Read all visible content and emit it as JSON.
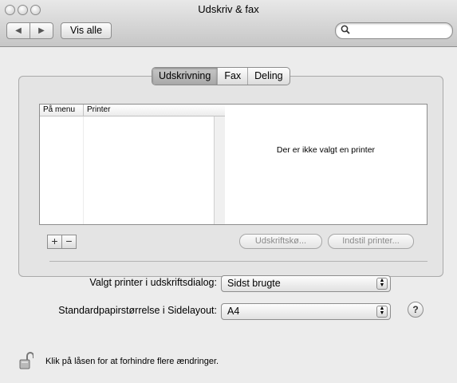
{
  "window": {
    "title": "Udskriv & fax"
  },
  "toolbar": {
    "back_icon": "back-arrow-icon",
    "forward_icon": "forward-arrow-icon",
    "show_all_label": "Vis alle",
    "search_value": ""
  },
  "tabs": [
    {
      "label": "Udskrivning",
      "active": true
    },
    {
      "label": "Fax",
      "active": false
    },
    {
      "label": "Deling",
      "active": false
    }
  ],
  "printer_list": {
    "columns": [
      "På menu",
      "Printer"
    ],
    "rows": []
  },
  "detail": {
    "message": "Der er ikke valgt en printer"
  },
  "list_buttons": {
    "add_label": "+",
    "remove_label": "−"
  },
  "actions": {
    "print_queue_label": "Udskriftskø...",
    "setup_printer_label": "Indstil printer..."
  },
  "selected_printer": {
    "label": "Valgt printer i udskriftsdialog:",
    "value": "Sidst brugte"
  },
  "paper_size": {
    "label": "Standardpapirstørrelse i Sidelayout:",
    "value": "A4"
  },
  "help_label": "?",
  "lock": {
    "text": "Klik på låsen for at forhindre flere ændringer."
  }
}
